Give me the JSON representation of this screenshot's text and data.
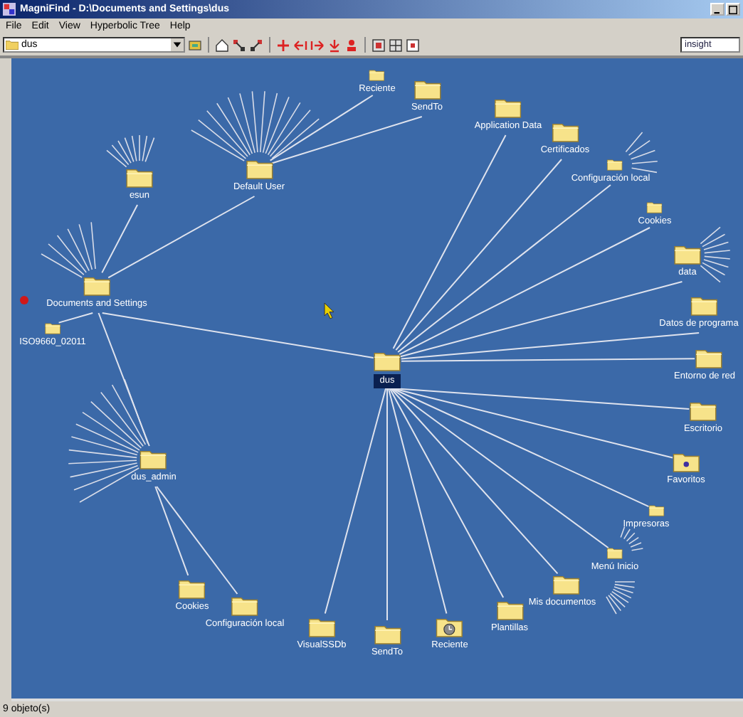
{
  "window": {
    "title": "MagniFind - D:\\Documents and Settings\\dus"
  },
  "menu": [
    "File",
    "Edit",
    "View",
    "Hyperbolic Tree",
    "Help"
  ],
  "toolbar": {
    "path": "dus",
    "search": "insight"
  },
  "tree": {
    "label": "Documents and Settings",
    "kind": "folder",
    "selected": false,
    "children": [
      {
        "label": "esun",
        "kind": "folder",
        "selected": false
      },
      {
        "label": "Default User",
        "kind": "folder",
        "selected": false,
        "children": [
          {
            "label": "Reciente",
            "kind": "folder",
            "selected": false
          },
          {
            "label": "SendTo",
            "kind": "folder",
            "selected": false
          }
        ]
      },
      {
        "label": "ISO9660_02011",
        "kind": "folder",
        "selected": false
      },
      {
        "label": "dus_admin",
        "kind": "folder",
        "selected": false,
        "children": [
          {
            "label": "Cookies",
            "kind": "folder",
            "selected": false
          },
          {
            "label": "Configuración local",
            "kind": "folder",
            "selected": false
          }
        ]
      },
      {
        "label": "dus",
        "kind": "folder",
        "selected": true,
        "children": [
          {
            "label": "Application Data",
            "kind": "folder",
            "selected": false
          },
          {
            "label": "Certificados",
            "kind": "folder",
            "selected": false
          },
          {
            "label": "Configuración local",
            "kind": "folder",
            "selected": false
          },
          {
            "label": "Cookies",
            "kind": "folder",
            "selected": false
          },
          {
            "label": "data",
            "kind": "folder",
            "selected": false
          },
          {
            "label": "Datos de programa",
            "kind": "folder",
            "selected": false
          },
          {
            "label": "Entorno de red",
            "kind": "folder",
            "selected": false
          },
          {
            "label": "Escritorio",
            "kind": "folder",
            "selected": false
          },
          {
            "label": "Favoritos",
            "kind": "favorites",
            "selected": false
          },
          {
            "label": "Impresoras",
            "kind": "folder",
            "selected": false
          },
          {
            "label": "Menú Inicio",
            "kind": "folder",
            "selected": false
          },
          {
            "label": "Mis documentos",
            "kind": "folder",
            "selected": false
          },
          {
            "label": "Plantillas",
            "kind": "folder",
            "selected": false
          },
          {
            "label": "Reciente",
            "kind": "recent",
            "selected": false
          },
          {
            "label": "SendTo",
            "kind": "folder",
            "selected": false
          },
          {
            "label": "VisualSSDb",
            "kind": "folder",
            "selected": false
          }
        ]
      }
    ]
  },
  "status_bar": "9 objeto(s)"
}
